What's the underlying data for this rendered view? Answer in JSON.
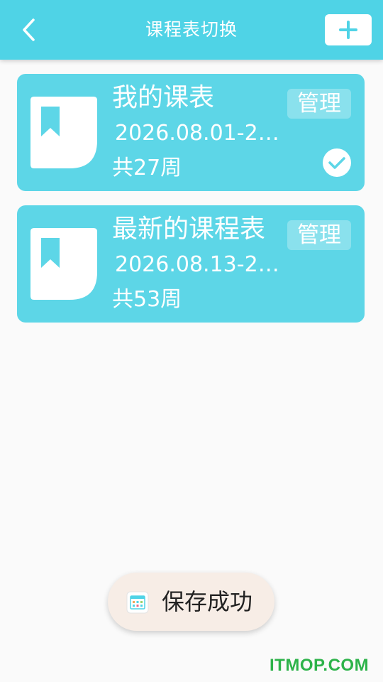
{
  "header": {
    "title": "课程表切换",
    "back_icon": "chevron-left-icon",
    "add_icon": "plus-icon"
  },
  "colors": {
    "header_bg": "#4fd3e6",
    "card_bg": "#5dd6e7",
    "page_bg": "#fafafa",
    "toast_bg": "#f7ede6",
    "watermark": "#2db34a"
  },
  "schedules": [
    {
      "name": "我的课表",
      "dates": "2026.08.01-20...",
      "weeks": "共27周",
      "manage_label": "管理",
      "selected": true,
      "icon": "bookmark-book-icon"
    },
    {
      "name": "最新的课程表",
      "dates": "2026.08.13-20...",
      "weeks": "共53周",
      "manage_label": "管理",
      "selected": false,
      "icon": "bookmark-book-icon"
    }
  ],
  "toast": {
    "text": "保存成功",
    "icon": "app-calendar-icon"
  },
  "watermark": "ITMOP.COM"
}
